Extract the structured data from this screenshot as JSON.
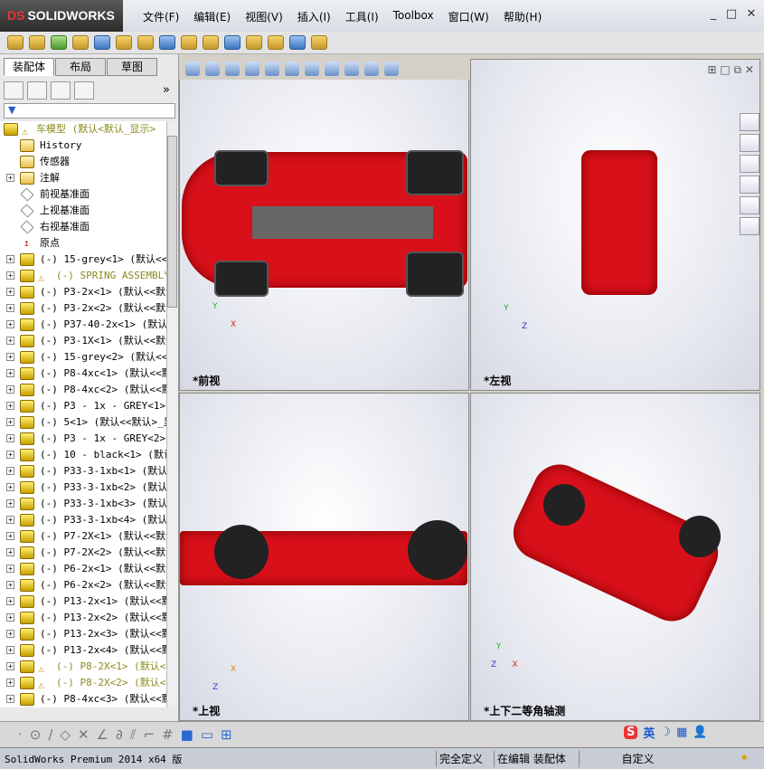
{
  "app": {
    "logo": "SOLIDWORKS",
    "logo_prefix": "DS"
  },
  "menu": [
    "文件(F)",
    "编辑(E)",
    "视图(V)",
    "插入(I)",
    "工具(I)",
    "Toolbox",
    "窗口(W)",
    "帮助(H)"
  ],
  "window_controls": [
    "minimize",
    "restore",
    "close"
  ],
  "left_panel": {
    "tabs": [
      "装配体",
      "布局",
      "草图"
    ],
    "active_tab": "装配体",
    "filter_icon": "funnel-icon"
  },
  "tree": [
    {
      "label": "车模型  (默认<默认_显示>",
      "warn": true,
      "top": true,
      "icon": "assembly"
    },
    {
      "label": "History",
      "icon": "folder"
    },
    {
      "label": "传感器",
      "icon": "folder"
    },
    {
      "label": "注解",
      "icon": "folder",
      "expand": true
    },
    {
      "label": "前视基准面",
      "icon": "plane"
    },
    {
      "label": "上视基准面",
      "icon": "plane"
    },
    {
      "label": "右视基准面",
      "icon": "plane"
    },
    {
      "label": "原点",
      "icon": "origin"
    },
    {
      "label": "(-) 15-grey<1> (默认<<默",
      "expand": true
    },
    {
      "label": "(-) SPRING ASSEMBLY<",
      "expand": true,
      "warn": true
    },
    {
      "label": "(-) P3-2x<1> (默认<<默认",
      "expand": true
    },
    {
      "label": "(-) P3-2x<2> (默认<<默认",
      "expand": true
    },
    {
      "label": "(-) P37-40-2x<1> (默认<",
      "expand": true
    },
    {
      "label": "(-) P3-1X<1> (默认<<默认",
      "expand": true
    },
    {
      "label": "(-) 15-grey<2> (默认<<默",
      "expand": true
    },
    {
      "label": "(-) P8-4xc<1> (默认<<默",
      "expand": true
    },
    {
      "label": "(-) P8-4xc<2> (默认<<默",
      "expand": true
    },
    {
      "label": "(-) P3 - 1x - GREY<1> (",
      "expand": true
    },
    {
      "label": "(-) 5<1> (默认<<默认>_显",
      "expand": true
    },
    {
      "label": "(-) P3 - 1x - GREY<2> (",
      "expand": true
    },
    {
      "label": "(-) 10 - black<1> (默认",
      "expand": true
    },
    {
      "label": "(-) P33-3-1xb<1> (默认<",
      "expand": true
    },
    {
      "label": "(-) P33-3-1xb<2> (默认<",
      "expand": true
    },
    {
      "label": "(-) P33-3-1xb<3> (默认<",
      "expand": true
    },
    {
      "label": "(-) P33-3-1xb<4> (默认<",
      "expand": true
    },
    {
      "label": "(-) P7-2X<1> (默认<<默认",
      "expand": true
    },
    {
      "label": "(-) P7-2X<2> (默认<<默认",
      "expand": true
    },
    {
      "label": "(-) P6-2x<1> (默认<<默认",
      "expand": true
    },
    {
      "label": "(-) P6-2x<2> (默认<<默认",
      "expand": true
    },
    {
      "label": "(-) P13-2x<1> (默认<<默",
      "expand": true
    },
    {
      "label": "(-) P13-2x<2> (默认<<默",
      "expand": true
    },
    {
      "label": "(-) P13-2x<3> (默认<<默",
      "expand": true
    },
    {
      "label": "(-) P13-2x<4> (默认<<默",
      "expand": true
    },
    {
      "label": "(-) P8-2X<1> (默认<<",
      "expand": true,
      "warn": true
    },
    {
      "label": "(-) P8-2X<2> (默认<<",
      "expand": true,
      "warn": true
    },
    {
      "label": "(-) P8-4xc<3> (默认<<默",
      "expand": true
    }
  ],
  "viewports": [
    {
      "label": "*前视",
      "axes": [
        "Y",
        "X"
      ]
    },
    {
      "label": "*左视",
      "axes": [
        "Y",
        "Z"
      ]
    },
    {
      "label": "*上视",
      "axes": [
        "X",
        "Z"
      ]
    },
    {
      "label": "*上下二等角轴测",
      "axes": [
        "Y",
        "X",
        "Z"
      ]
    }
  ],
  "status": {
    "product": "SolidWorks Premium 2014 x64 版",
    "state": "完全定义",
    "mode": "在编辑 装配体",
    "units": "自定义"
  },
  "ime": {
    "lang": "英"
  },
  "colors": {
    "model_red": "#d8101a",
    "warning": "#8a8a20"
  }
}
